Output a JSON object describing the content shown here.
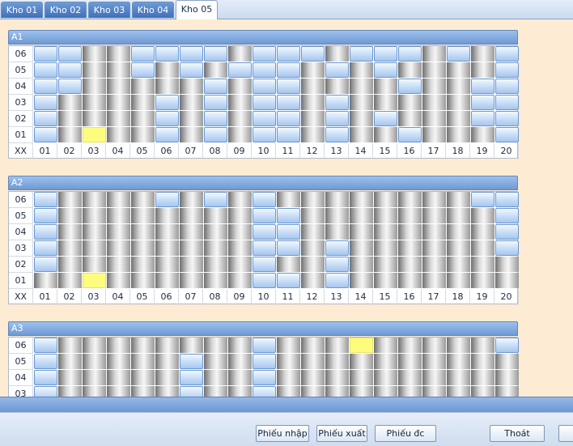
{
  "tabs": [
    "Kho 01",
    "Kho 02",
    "Kho 03",
    "Kho 04",
    "Kho 05"
  ],
  "active_tab": "Kho 05",
  "grid_corner_label": "XX",
  "row_labels": [
    "06",
    "05",
    "04",
    "03",
    "02",
    "01"
  ],
  "column_labels": [
    "01",
    "02",
    "03",
    "04",
    "05",
    "06",
    "07",
    "08",
    "09",
    "10",
    "11",
    "12",
    "13",
    "14",
    "15",
    "16",
    "17",
    "18",
    "19",
    "20"
  ],
  "cell_legend": {
    "b": "blue slot",
    "g": "gray slot",
    "y": "yellow slot"
  },
  "colors": {
    "blue_slot": "#c6dcf6",
    "gray_slot": "#9a9a9a",
    "yellow_slot": "#fefc7c",
    "content_bg": "#fdebd3",
    "header_blue": "#6e99d6"
  },
  "sections": [
    {
      "title": "A1",
      "rows": [
        "bbggbbbbgbbbgbbbgbgb",
        "bbggbgbgbbbgbgbggggb",
        "bbgggggbgbbggggbggbb",
        "bggggbgbgbbgbgggggbb",
        "bggggbgbgbbgbgbgggbb",
        "bgyggbgbgbbgbggbgggb"
      ]
    },
    {
      "title": "A2",
      "rows": [
        "bggggbgbgbggggggggbb",
        "bggggggggbbggggggggb",
        "bggggggggbbggggggggb",
        "bggggggggbbgbggggggb",
        "bggggggggbggbggggggg",
        "ggyggggggbbgbggggggg"
      ]
    },
    {
      "title": "A3",
      "rows": [
        "bggggggggbgggygggggb",
        "bgggggbggbgggggggggg",
        "bgggggbggbgggggggggg",
        "bgggggbggbgggggggggg"
      ]
    }
  ],
  "buttons": {
    "phieu_nhap": "Phiếu nhập",
    "phieu_xuat": "Phiếu xuất",
    "phieu_dc": "Phiếu đc",
    "thoat": "Thoát"
  }
}
